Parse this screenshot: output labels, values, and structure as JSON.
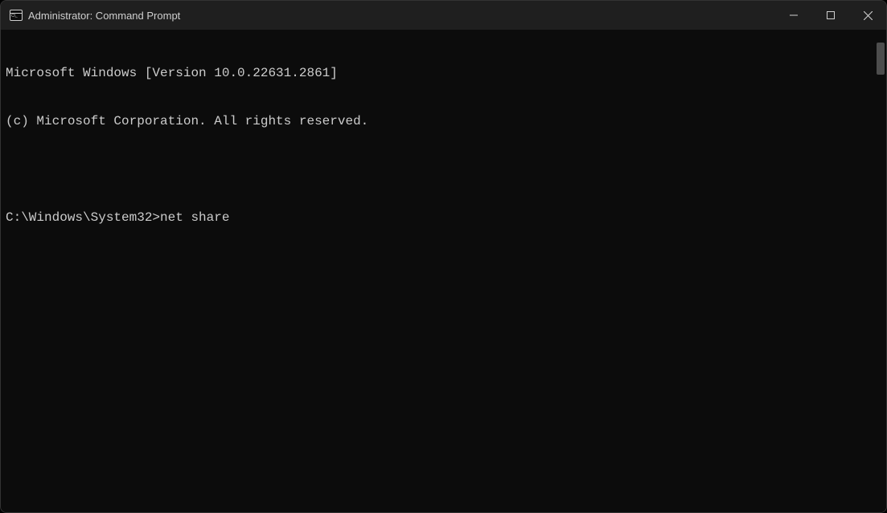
{
  "titlebar": {
    "title": "Administrator: Command Prompt"
  },
  "terminal": {
    "line1": "Microsoft Windows [Version 10.0.22631.2861]",
    "line2": "(c) Microsoft Corporation. All rights reserved.",
    "prompt": "C:\\Windows\\System32>",
    "command": "net share"
  }
}
